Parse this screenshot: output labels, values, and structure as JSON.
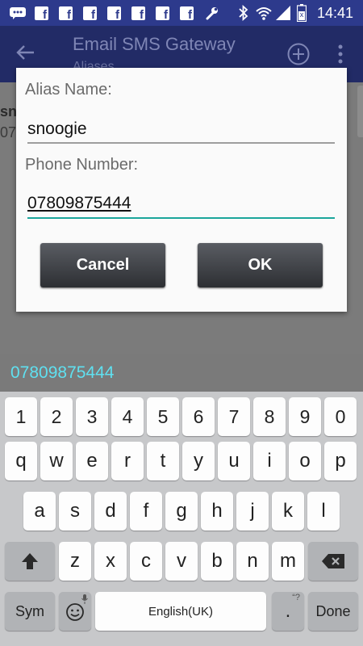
{
  "status_bar": {
    "time": "14:41",
    "icons": [
      "messages-icon",
      "facebook-icon",
      "facebook-icon",
      "facebook-icon",
      "facebook-icon",
      "facebook-icon",
      "facebook-icon",
      "facebook-icon",
      "wrench-icon",
      "bluetooth-icon",
      "wifi-icon",
      "signal-icon",
      "battery-icon"
    ]
  },
  "app_bar": {
    "title": "Email SMS Gateway",
    "subtitle": "Aliases"
  },
  "background_list": {
    "peek_line1": "sn",
    "peek_line2": "07"
  },
  "dialog": {
    "alias_label": "Alias Name:",
    "alias_value": "snoogie",
    "phone_label": "Phone Number:",
    "phone_value": "07809875444",
    "cancel_label": "Cancel",
    "ok_label": "OK"
  },
  "suggestion_bar": {
    "suggestion": "07809875444"
  },
  "keyboard": {
    "number_row": [
      "1",
      "2",
      "3",
      "4",
      "5",
      "6",
      "7",
      "8",
      "9",
      "0"
    ],
    "row1": [
      "q",
      "w",
      "e",
      "r",
      "t",
      "y",
      "u",
      "i",
      "o",
      "p"
    ],
    "row2": [
      "a",
      "s",
      "d",
      "f",
      "g",
      "h",
      "j",
      "k",
      "l"
    ],
    "row3": [
      "z",
      "x",
      "c",
      "v",
      "b",
      "n",
      "m"
    ],
    "sym_label": "Sym",
    "space_label": "English(UK)",
    "period_label": ".",
    "done_label": "Done"
  },
  "colors": {
    "status_bar": "#2d3a8c",
    "app_bar_dimmed": "#222b66",
    "accent_underline": "#1ba69b",
    "suggestion_text": "#5fe0f0"
  }
}
